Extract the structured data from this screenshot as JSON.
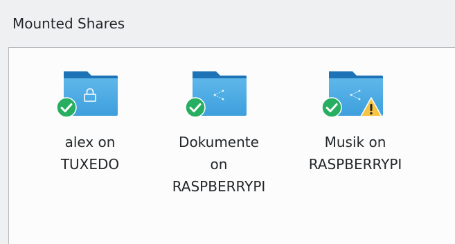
{
  "panel": {
    "title": "Mounted Shares"
  },
  "shares": [
    {
      "label_lines": [
        "alex on",
        "TUXEDO"
      ],
      "folder_emblem": "lock-icon",
      "status_badge": "check-icon",
      "warning": false
    },
    {
      "label_lines": [
        "Dokumente",
        "on",
        "RASPBERRYPI"
      ],
      "folder_emblem": "network-share-icon",
      "status_badge": "check-icon",
      "warning": false
    },
    {
      "label_lines": [
        "Musik on",
        "RASPBERRYPI"
      ],
      "folder_emblem": "network-share-icon",
      "status_badge": "check-icon",
      "warning": true
    }
  ],
  "colors": {
    "folder_back": "#1d73b5",
    "folder_front_top": "#5eb7ea",
    "folder_front_bottom": "#3d9fdc",
    "check_badge": "#27ae60",
    "warning_badge": "#f6c342"
  }
}
